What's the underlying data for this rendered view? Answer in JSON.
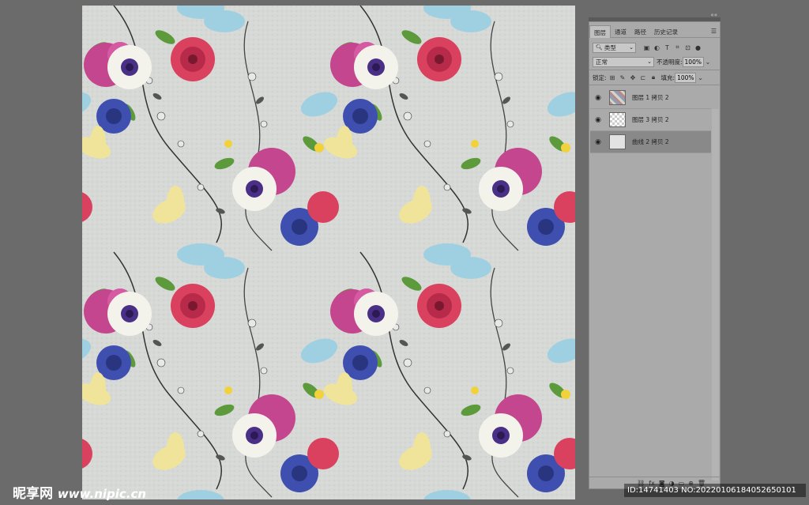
{
  "panel": {
    "tabs": [
      {
        "label": "图层"
      },
      {
        "label": "通道"
      },
      {
        "label": "路径"
      },
      {
        "label": "历史记录"
      }
    ],
    "filter": {
      "label": "类型"
    },
    "blend_mode": "正常",
    "opacity": {
      "label": "不透明度:",
      "value": "100%"
    },
    "lock": {
      "label": "锁定:"
    },
    "fill": {
      "label": "填充:",
      "value": "100%"
    },
    "layers": [
      {
        "name": "图层 1 拷贝 2",
        "selected": false
      },
      {
        "name": "图层 3 拷贝 2",
        "selected": false
      },
      {
        "name": "曲线 2 拷贝 2",
        "selected": true
      }
    ]
  },
  "watermark": {
    "left_brand": "昵享网",
    "left_url": "www.nipic.cn",
    "right_id": "ID:14741403 NO:20220106184052650101"
  },
  "colors": {
    "background": "#6b6b6b",
    "panel": "#aaaaaa",
    "canvas_base": "#d6d9d5",
    "magenta_flower": "#c4468f",
    "white_flower": "#f3f3ec",
    "purple_center": "#4a2f86",
    "blue_flower": "#3f4fb0",
    "pink_flower": "#d9415f",
    "yellow_flower": "#f0e39a",
    "light_blue_flower": "#9fd0e2",
    "leaf_green": "#5c9a3c"
  }
}
